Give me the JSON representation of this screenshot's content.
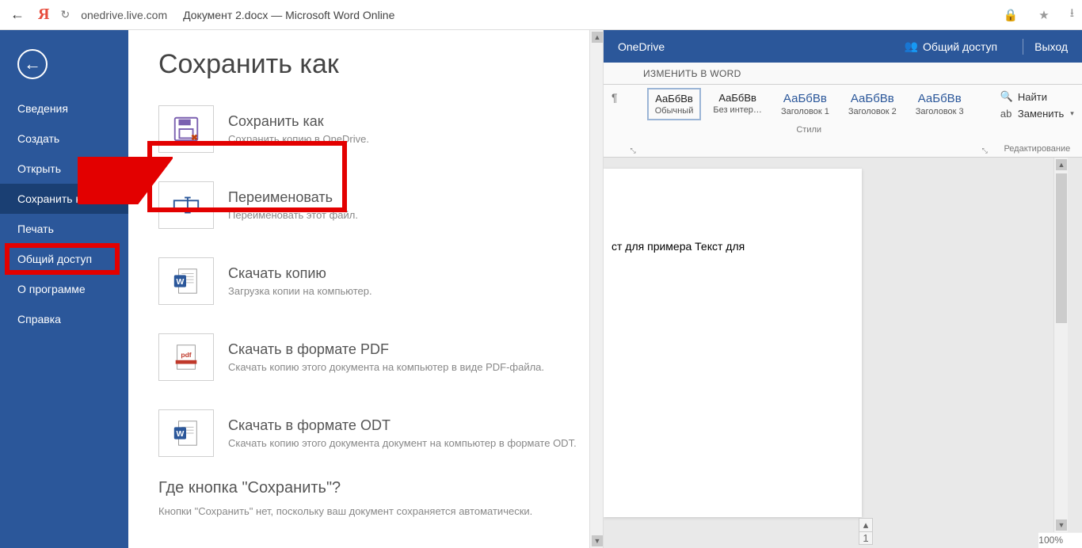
{
  "browser": {
    "url": "onedrive.live.com",
    "title": "Документ 2.docx — Microsoft Word Online"
  },
  "sidebar": {
    "items": [
      "Сведения",
      "Создать",
      "Открыть",
      "Сохранить как",
      "Печать",
      "Общий доступ",
      "О программе",
      "Справка"
    ],
    "active_index": 3
  },
  "page": {
    "title": "Сохранить как",
    "options": [
      {
        "title": "Сохранить как",
        "desc": "Сохранить копию в OneDrive."
      },
      {
        "title": "Переименовать",
        "desc": "Переименовать этот файл."
      },
      {
        "title": "Скачать копию",
        "desc": "Загрузка копии на компьютер."
      },
      {
        "title": "Скачать в формате PDF",
        "desc": "Скачать копию этого документа на компьютер в виде PDF-файла."
      },
      {
        "title": "Скачать в формате ODT",
        "desc": "Скачать копию этого документа документ на компьютер в формате ODT."
      }
    ],
    "footer_q": "Где кнопка \"Сохранить\"?",
    "footer_note": "Кнопки \"Сохранить\" нет, поскольку ваш документ сохраняется автоматически."
  },
  "right": {
    "onedrive": "OneDrive",
    "share": "Общий доступ",
    "exit": "Выход",
    "tab_edit": "ИЗМЕНИТЬ В WORD",
    "pilcrow": "¶",
    "styles": [
      {
        "sample": "АаБбВв",
        "label": "Обычный",
        "selected": true
      },
      {
        "sample": "АаБбВв",
        "label": "Без интер…"
      },
      {
        "sample": "АаБбВв",
        "label": "Заголовок 1",
        "blue": true
      },
      {
        "sample": "АаБбВв",
        "label": "Заголовок 2",
        "blue": true
      },
      {
        "sample": "АаБбВв",
        "label": "Заголовок 3",
        "blue": true
      }
    ],
    "styles_label": "Стили",
    "find": "Найти",
    "replace": "Заменить",
    "editing_label": "Редактирование",
    "doc_text": "ст для примера Текст для",
    "page_num": "1",
    "zoom": "100%"
  }
}
